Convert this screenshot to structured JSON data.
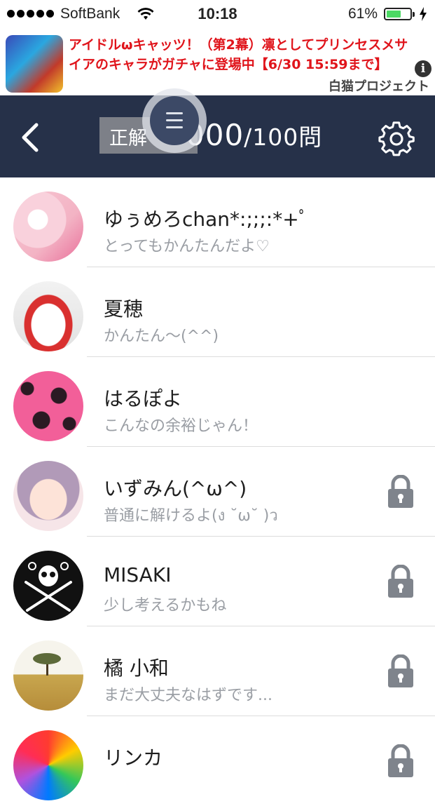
{
  "status_bar": {
    "carrier": "SoftBank",
    "time": "10:18",
    "battery_percent": "61%",
    "battery_level": 0.61
  },
  "ad": {
    "text": "アイドルωキャッツ！（第2幕）凛としてプリンセスメサイアのキャラがガチャに登場中【6/30 15:59まで】",
    "sponsor": "白猫プロジェクト",
    "info_icon": "i"
  },
  "header": {
    "score_label": "正解",
    "score_value": "000",
    "score_suffix": "/100問",
    "back_icon": "chevron-left-icon",
    "menu_icon": "hamburger-menu-icon",
    "settings_icon": "gear-icon",
    "background": "#263149"
  },
  "contacts": [
    {
      "name": "ゆぅめろchan*:;;;:*+ﾟ",
      "message": "とってもかんたんだよ♡",
      "locked": false
    },
    {
      "name": "夏穂",
      "message": "かんたん〜(^^)",
      "locked": false
    },
    {
      "name": "はるぽよ",
      "message": "こんなの余裕じゃん！",
      "locked": false
    },
    {
      "name": "いずみん(^ω^)",
      "message": "普通に解けるよ(ง ˘ω˘ )ว",
      "locked": true
    },
    {
      "name": "MISAKI",
      "message": "少し考えるかもね",
      "locked": true
    },
    {
      "name": "橘 小和",
      "message": "まだ大丈夫なはずです...",
      "locked": true
    },
    {
      "name": "リンカ",
      "message": "",
      "locked": true
    }
  ]
}
